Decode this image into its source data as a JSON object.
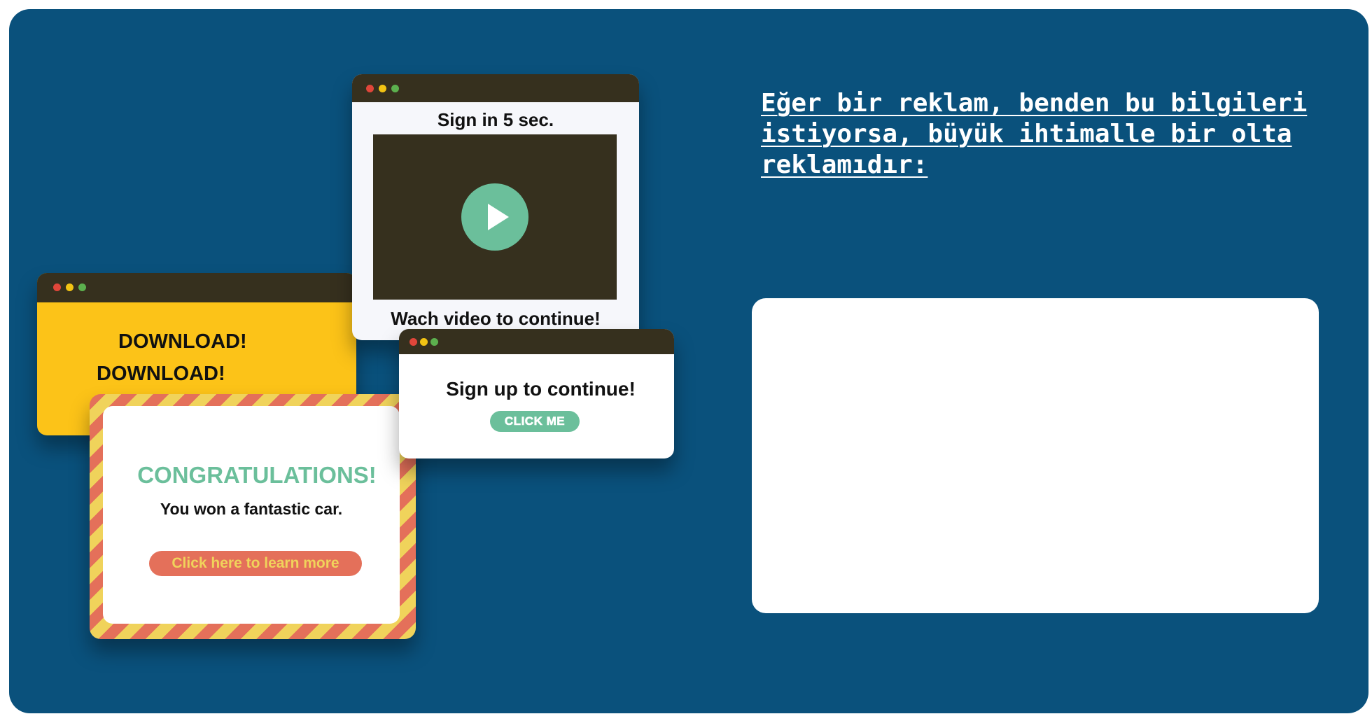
{
  "colors": {
    "background": "#0a517c",
    "titlebar": "#36301e",
    "download_window": "#fcc318",
    "accent_green": "#6bbf9b",
    "stripe_red": "#e4705a",
    "stripe_yellow": "#f0d35b"
  },
  "heading": "Eğer bir reklam, benden bu bilgileri istiyorsa, büyük ihtimalle bir olta reklamıdır:",
  "ads": {
    "download": {
      "line1": "DOWNLOAD!",
      "line2": "DOWNLOAD!"
    },
    "video": {
      "title": "Sign in 5 sec.",
      "play_icon": "play-icon",
      "caption": "Wach video to continue!"
    },
    "signup": {
      "title": "Sign up to continue!",
      "button": "CLICK ME"
    },
    "congrats": {
      "title": "CONGRATULATIONS!",
      "subtitle": "You won a fantastic car.",
      "button": "Click here to learn more"
    }
  }
}
